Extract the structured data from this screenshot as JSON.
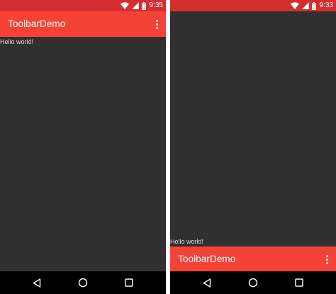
{
  "left_screen": {
    "status_bar": {
      "time": "9:35"
    },
    "toolbar": {
      "title": "ToolbarDemo",
      "overflow_icon": "more-vert-icon"
    },
    "content": {
      "text": "Hello world!"
    }
  },
  "right_screen": {
    "status_bar": {
      "time": "9:33"
    },
    "toolbar": {
      "title": "ToolbarDemo",
      "overflow_icon": "more-vert-icon"
    },
    "content": {
      "text": "Hello world!"
    }
  },
  "nav_bar": {
    "icons": [
      "back-icon",
      "home-icon",
      "recents-icon"
    ]
  },
  "colors": {
    "status_bar": "#d32f2f",
    "toolbar": "#f44336",
    "background": "#303030",
    "nav_bar": "#000000",
    "content_text": "#dcdcdc"
  }
}
